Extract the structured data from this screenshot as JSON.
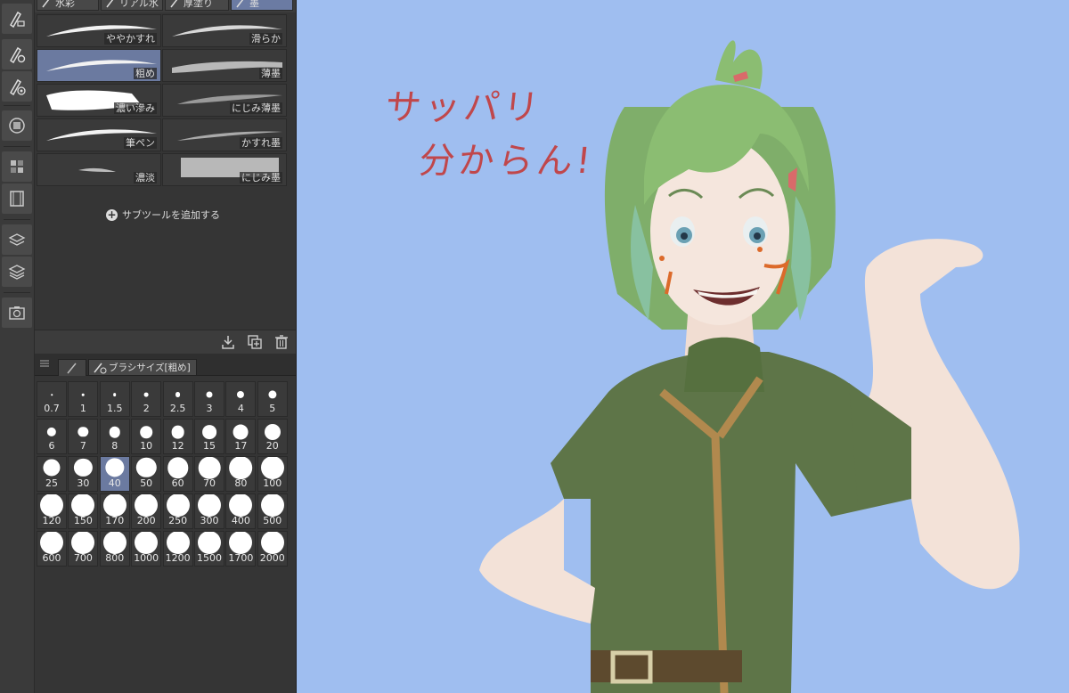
{
  "subtool_tabs": [
    {
      "label": "水彩",
      "active": false
    },
    {
      "label": "リアル水",
      "active": false
    },
    {
      "label": "厚塗り",
      "active": false
    },
    {
      "label": "墨",
      "active": true
    }
  ],
  "brushes": [
    {
      "label": "ややかすれ",
      "selected": false,
      "stroke": "taper"
    },
    {
      "label": "滑らか",
      "selected": false,
      "stroke": "taper-dark"
    },
    {
      "label": "粗め",
      "selected": true,
      "stroke": "taper"
    },
    {
      "label": "薄墨",
      "selected": false,
      "stroke": "rough"
    },
    {
      "label": "濃い滲み",
      "selected": false,
      "stroke": "blot"
    },
    {
      "label": "にじみ薄墨",
      "selected": false,
      "stroke": "soft"
    },
    {
      "label": "筆ペン",
      "selected": false,
      "stroke": "taper"
    },
    {
      "label": "かすれ墨",
      "selected": false,
      "stroke": "thin"
    },
    {
      "label": "濃淡",
      "selected": false,
      "stroke": "fade"
    },
    {
      "label": "にじみ墨",
      "selected": false,
      "stroke": "block"
    }
  ],
  "add_subtool_label": "サブツールを追加する",
  "brush_size_tab": "ブラシサイズ[粗め]",
  "selected_size": "40",
  "brush_sizes": [
    "0.7",
    "1",
    "1.5",
    "2",
    "2.5",
    "3",
    "4",
    "5",
    "6",
    "7",
    "8",
    "10",
    "12",
    "15",
    "17",
    "20",
    "25",
    "30",
    "40",
    "50",
    "60",
    "70",
    "80",
    "100",
    "120",
    "150",
    "170",
    "200",
    "250",
    "300",
    "400",
    "500",
    "600",
    "700",
    "800",
    "1000",
    "1200",
    "1500",
    "1700",
    "2000"
  ],
  "canvas": {
    "background": "#9fbef0",
    "handwriting_line1": "サッパリ",
    "handwriting_line2": "分からん!",
    "handwriting_color": "#c0474b"
  },
  "toolbar_icons": [
    "pen-brush-icon",
    "brush-settings-icon",
    "brush-target-icon",
    "layer-color-icon",
    "grid-icon",
    "filmstrip-icon",
    "layers-properties-icon",
    "layers-icon",
    "camera-icon"
  ],
  "colors": {
    "selected": "#6b7aa0",
    "panel": "#353535"
  }
}
